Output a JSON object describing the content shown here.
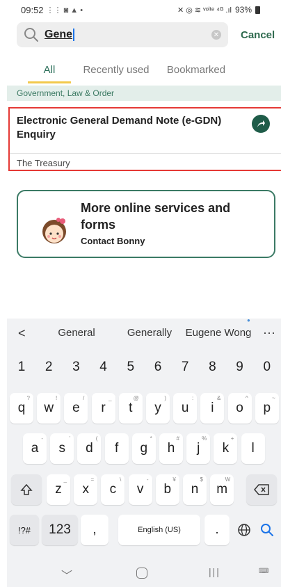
{
  "status_bar": {
    "time": "09:52",
    "left_icons": "⋮⋮ ◙ ▲ •",
    "right_icons": "✕ ◎ ≋ ᵛᵒˡᵗᵉ ⁴ᴳ .ıl",
    "battery": "93%"
  },
  "search": {
    "value": "Gene",
    "cancel_label": "Cancel"
  },
  "tabs": [
    {
      "label": "All",
      "active": true
    },
    {
      "label": "Recently used",
      "active": false
    },
    {
      "label": "Bookmarked",
      "active": false
    }
  ],
  "category": "Government, Law & Order",
  "result": {
    "title": "Electronic General Demand Note (e-GDN) Enquiry",
    "department": "The Treasury"
  },
  "more": {
    "title": "More online services and forms",
    "subtitle": "Contact Bonny"
  },
  "keyboard": {
    "suggestions": [
      "General",
      "Generally",
      "Eugene Wong"
    ],
    "numbers": [
      "1",
      "2",
      "3",
      "4",
      "5",
      "6",
      "7",
      "8",
      "9",
      "0"
    ],
    "row1": [
      "q",
      "w",
      "e",
      "r",
      "t",
      "y",
      "u",
      "i",
      "o",
      "p"
    ],
    "row1_sup": [
      "?",
      "!",
      "/",
      "_",
      "@",
      ")",
      ":",
      "&",
      "^",
      "~"
    ],
    "row2": [
      "a",
      "s",
      "d",
      "f",
      "g",
      "h",
      "j",
      "k",
      "l"
    ],
    "row2_sup": [
      "-",
      "'",
      "(",
      "",
      "*",
      "#",
      "%",
      "+",
      ""
    ],
    "row3": [
      "z",
      "x",
      "c",
      "v",
      "b",
      "n",
      "m"
    ],
    "row3_sup": [
      "_",
      "=",
      "\\",
      "-",
      "¥",
      "$",
      "W"
    ],
    "sym_label": "!?#",
    "num_label": "123",
    "comma": ",",
    "space_label": "English (US)",
    "period": "."
  },
  "colors": {
    "accent_green": "#1f5c49",
    "tab_underline": "#f2c94c",
    "highlight_border": "#e53935"
  }
}
